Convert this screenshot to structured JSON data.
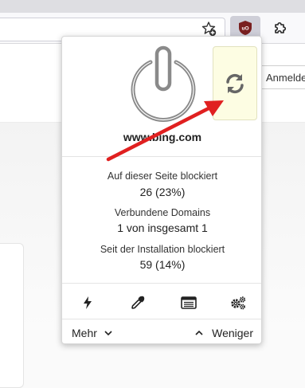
{
  "toolbar": {
    "star_icon": "star-plus-icon",
    "ublock_icon": "ublock-origin-icon",
    "ublock_badge_text": "uO",
    "extensions_icon": "puzzle-icon"
  },
  "page": {
    "login_button": "Anmelden"
  },
  "popup": {
    "hostname": "www.bing.com",
    "power_icon": "power-icon",
    "refresh_icon": "refresh-icon",
    "refresh_bg": "#fdfde3",
    "stats": [
      {
        "label": "Auf dieser Seite blockiert",
        "value": "26 (23%)"
      },
      {
        "label": "Verbundene Domains",
        "value": "1 von insgesamt 1"
      },
      {
        "label": "Seit der Installation blockiert",
        "value": "59 (14%)"
      }
    ],
    "tools": [
      "lightning-icon",
      "eyedropper-icon",
      "logger-icon",
      "settings-icon"
    ],
    "footer": {
      "more_label": "Mehr",
      "less_label": "Weniger"
    }
  },
  "annotation": {
    "arrow_color": "#e02020"
  }
}
